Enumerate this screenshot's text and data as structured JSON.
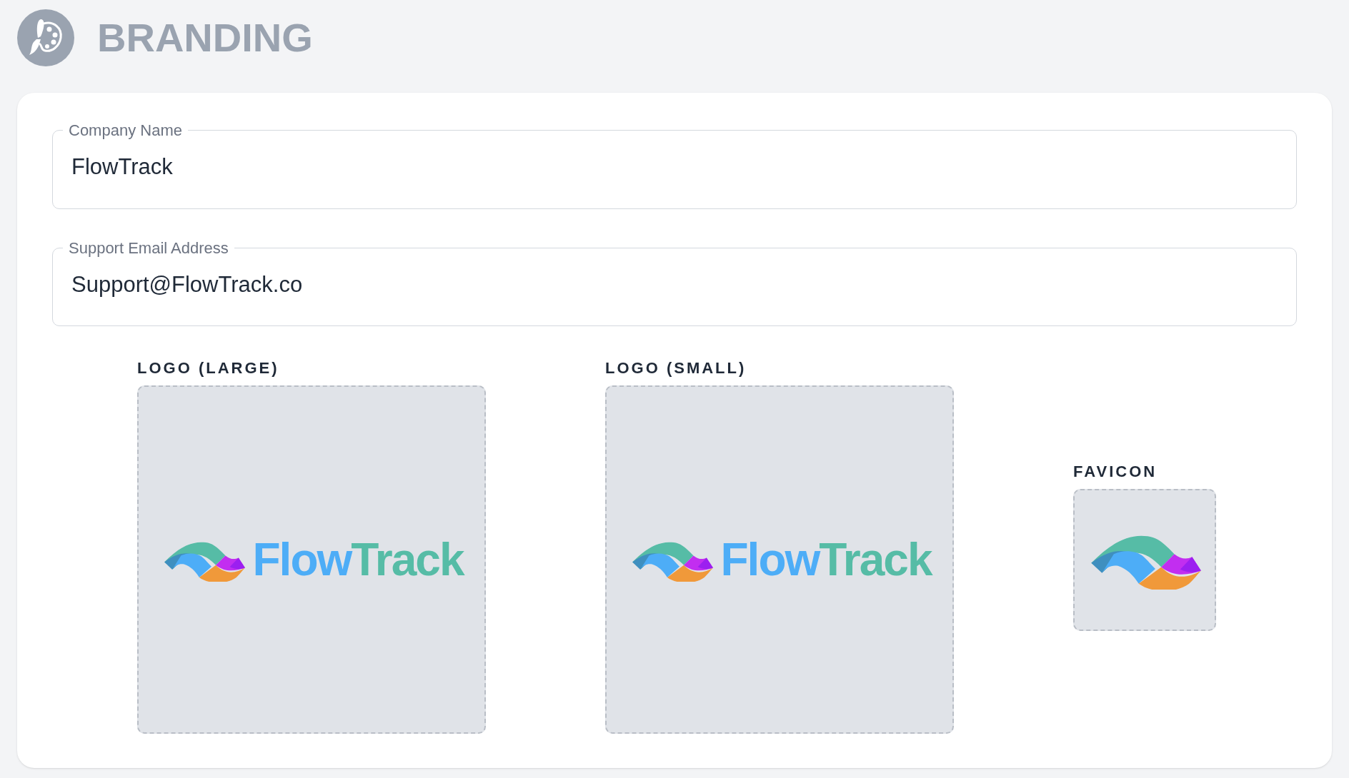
{
  "header": {
    "title": "BRANDING"
  },
  "fields": [
    {
      "label": "Company Name",
      "value": "FlowTrack"
    },
    {
      "label": "Support Email Address",
      "value": "Support@FlowTrack.co"
    }
  ],
  "images": [
    {
      "label": "LOGO (LARGE)",
      "kind": "logo",
      "wordmark": [
        {
          "text": "Flow",
          "color": "#4dadf7"
        },
        {
          "text": "Track",
          "color": "#56bca6"
        }
      ]
    },
    {
      "label": "LOGO (SMALL)",
      "kind": "logo",
      "wordmark": [
        {
          "text": "Flow",
          "color": "#4dadf7"
        },
        {
          "text": "Track",
          "color": "#56bca6"
        }
      ]
    },
    {
      "label": "FAVICON",
      "kind": "favicon"
    }
  ]
}
